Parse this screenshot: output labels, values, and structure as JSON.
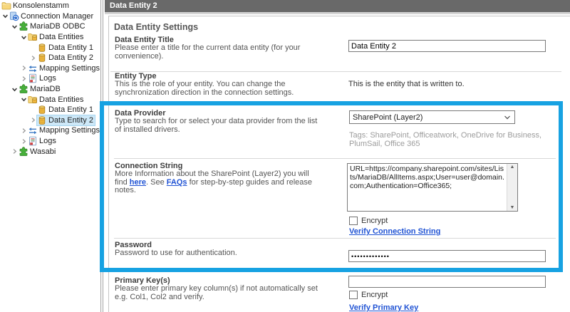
{
  "colors": {
    "highlight": "#17A2E2",
    "header_bar": "#696969",
    "tree_selection": "#CDE8F8",
    "link": "#2053D4"
  },
  "tree": {
    "items": [
      {
        "label": "Konsolenstamm",
        "depth": 0,
        "chevron": "none",
        "icon": "folder",
        "selected": false
      },
      {
        "label": "Connection Manager",
        "depth": 0,
        "chevron": "expanded",
        "icon": "connection-manager",
        "selected": false
      },
      {
        "label": "MariaDB ODBC",
        "depth": 1,
        "chevron": "expanded",
        "icon": "plugin",
        "selected": false
      },
      {
        "label": "Data Entities",
        "depth": 2,
        "chevron": "expanded",
        "icon": "entities-folder",
        "selected": false
      },
      {
        "label": "Data Entity 1",
        "depth": 3,
        "chevron": "none",
        "icon": "entity",
        "selected": false
      },
      {
        "label": "Data Entity 2",
        "depth": 3,
        "chevron": "collapsed",
        "icon": "entity",
        "selected": false
      },
      {
        "label": "Mapping Settings",
        "depth": 2,
        "chevron": "collapsed",
        "icon": "mapping",
        "selected": false
      },
      {
        "label": "Logs",
        "depth": 2,
        "chevron": "collapsed",
        "icon": "logs",
        "selected": false
      },
      {
        "label": "MariaDB",
        "depth": 1,
        "chevron": "expanded",
        "icon": "plugin",
        "selected": false
      },
      {
        "label": "Data Entities",
        "depth": 2,
        "chevron": "expanded",
        "icon": "entities-folder",
        "selected": false
      },
      {
        "label": "Data Entity 1",
        "depth": 3,
        "chevron": "none",
        "icon": "entity",
        "selected": false
      },
      {
        "label": "Data Entity 2",
        "depth": 3,
        "chevron": "collapsed",
        "icon": "entity",
        "selected": true
      },
      {
        "label": "Mapping Settings",
        "depth": 2,
        "chevron": "collapsed",
        "icon": "mapping",
        "selected": false
      },
      {
        "label": "Logs",
        "depth": 2,
        "chevron": "collapsed",
        "icon": "logs",
        "selected": false
      },
      {
        "label": "Wasabi",
        "depth": 1,
        "chevron": "collapsed",
        "icon": "plugin",
        "selected": false
      }
    ]
  },
  "header": {
    "title": "Data Entity 2"
  },
  "form": {
    "section_title": "Data Entity Settings",
    "title": {
      "label": "Data Entity Title",
      "desc": "Please enter a title for the current data entity (for your convenience).",
      "value": "Data Entity 2"
    },
    "entity_type": {
      "label": "Entity Type",
      "desc": "This is the role of your entity. You can change the synchronization direction in the connection settings.",
      "value": "This is the entity that is written to."
    },
    "data_provider": {
      "label": "Data Provider",
      "desc": "Type to search for or select your data provider from the list of installed drivers.",
      "selected": "SharePoint (Layer2)",
      "tags": "Tags: SharePoint, Officeatwork, OneDrive for Business, PlumSail, Office 365"
    },
    "connection_string": {
      "label": "Connection String",
      "desc_part1": "More Information about the SharePoint (Layer2) you will find ",
      "link_here": "here",
      "desc_part2": ". See ",
      "link_faqs": "FAQs",
      "desc_part3": " for step-by-step guides and release notes.",
      "value": "URL=https://company.sharepoint.com/sites/Lists/MariaDB/AllItems.aspx;User=user@domain.com;Authentication=Office365;",
      "encrypt_label": "Encrypt",
      "verify_link": "Verify Connection String"
    },
    "password": {
      "label": "Password",
      "desc": "Password to use for authentication.",
      "value": "•••••••••••••"
    },
    "primary_key": {
      "label": "Primary Key(s)",
      "desc": "Please enter primary key column(s) if not automatically set e.g. Col1, Col2 and verify.",
      "value": "",
      "encrypt_label": "Encrypt",
      "verify_link": "Verify Primary Key"
    }
  }
}
